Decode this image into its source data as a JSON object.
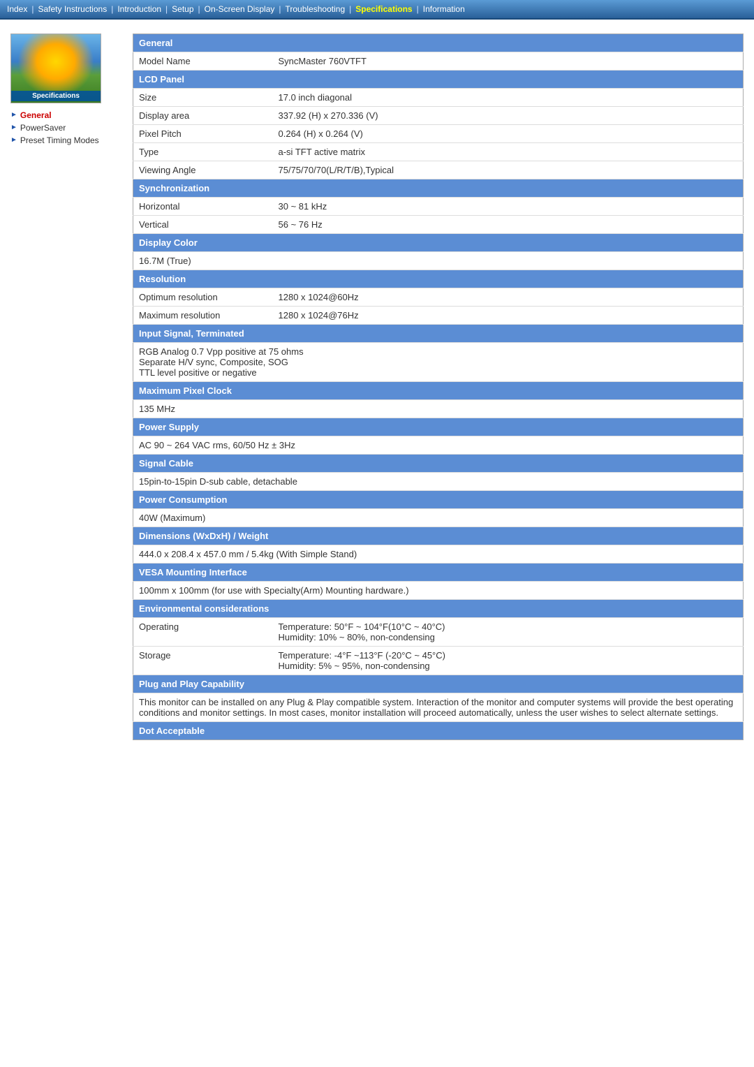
{
  "nav": {
    "items": [
      {
        "label": "Index",
        "active": false
      },
      {
        "label": "Safety Instructions",
        "active": false
      },
      {
        "label": "Introduction",
        "active": false
      },
      {
        "label": "Setup",
        "active": false
      },
      {
        "label": "On-Screen Display",
        "active": false
      },
      {
        "label": "Troubleshooting",
        "active": false
      },
      {
        "label": "Specifications",
        "active": true
      },
      {
        "label": "Information",
        "active": false
      }
    ]
  },
  "sidebar": {
    "logo_text": "Specifications",
    "items": [
      {
        "label": "General",
        "active": true
      },
      {
        "label": "PowerSaver",
        "active": false
      },
      {
        "label": "Preset Timing Modes",
        "active": false
      }
    ]
  },
  "specs": {
    "sections": [
      {
        "type": "header",
        "label": "General"
      },
      {
        "type": "row",
        "label": "Model Name",
        "value": "SyncMaster 760VTFT"
      },
      {
        "type": "header",
        "label": "LCD Panel"
      },
      {
        "type": "row",
        "label": "Size",
        "value": "17.0 inch diagonal"
      },
      {
        "type": "row",
        "label": "Display area",
        "value": "337.92 (H) x 270.336 (V)"
      },
      {
        "type": "row",
        "label": "Pixel Pitch",
        "value": "0.264 (H) x 0.264 (V)"
      },
      {
        "type": "row",
        "label": "Type",
        "value": "a-si TFT active matrix"
      },
      {
        "type": "row",
        "label": "Viewing Angle",
        "value": "75/75/70/70(L/R/T/B),Typical"
      },
      {
        "type": "header",
        "label": "Synchronization"
      },
      {
        "type": "row",
        "label": "Horizontal",
        "value": "30 ~ 81 kHz"
      },
      {
        "type": "row",
        "label": "Vertical",
        "value": "56 ~ 76 Hz"
      },
      {
        "type": "header",
        "label": "Display Color"
      },
      {
        "type": "full",
        "value": "16.7M (True)"
      },
      {
        "type": "header",
        "label": "Resolution"
      },
      {
        "type": "row",
        "label": "Optimum resolution",
        "value": "1280 x 1024@60Hz"
      },
      {
        "type": "row",
        "label": "Maximum resolution",
        "value": "1280 x 1024@76Hz"
      },
      {
        "type": "header",
        "label": "Input Signal, Terminated"
      },
      {
        "type": "full",
        "value": "RGB Analog 0.7 Vpp positive at 75 ohms\nSeparate H/V sync, Composite, SOG\nTTL level positive or negative"
      },
      {
        "type": "header",
        "label": "Maximum Pixel Clock"
      },
      {
        "type": "full",
        "value": "135 MHz"
      },
      {
        "type": "header",
        "label": "Power Supply"
      },
      {
        "type": "full",
        "value": "AC 90 ~ 264 VAC rms, 60/50 Hz ± 3Hz"
      },
      {
        "type": "header",
        "label": "Signal Cable"
      },
      {
        "type": "full",
        "value": "15pin-to-15pin D-sub cable, detachable"
      },
      {
        "type": "header",
        "label": "Power Consumption"
      },
      {
        "type": "full",
        "value": "40W (Maximum)"
      },
      {
        "type": "header",
        "label": "Dimensions (WxDxH) / Weight"
      },
      {
        "type": "full",
        "value": "444.0 x 208.4 x 457.0 mm / 5.4kg (With Simple Stand)"
      },
      {
        "type": "header",
        "label": "VESA Mounting Interface"
      },
      {
        "type": "full",
        "value": "100mm x 100mm (for use with Specialty(Arm) Mounting hardware.)"
      },
      {
        "type": "header",
        "label": "Environmental considerations"
      },
      {
        "type": "row",
        "label": "Operating",
        "value": "Temperature: 50°F ~ 104°F(10°C ~ 40°C)\nHumidity: 10% ~ 80%, non-condensing"
      },
      {
        "type": "row",
        "label": "Storage",
        "value": "Temperature: -4°F ~113°F (-20°C ~ 45°C)\nHumidity: 5% ~ 95%, non-condensing"
      },
      {
        "type": "header",
        "label": "Plug and Play Capability"
      },
      {
        "type": "full",
        "value": "This monitor can be installed on any Plug & Play compatible system. Interaction of the monitor and computer systems will provide the best operating conditions and monitor settings. In most cases, monitor installation will proceed automatically, unless the user wishes to select alternate settings."
      },
      {
        "type": "header",
        "label": "Dot Acceptable"
      }
    ]
  }
}
